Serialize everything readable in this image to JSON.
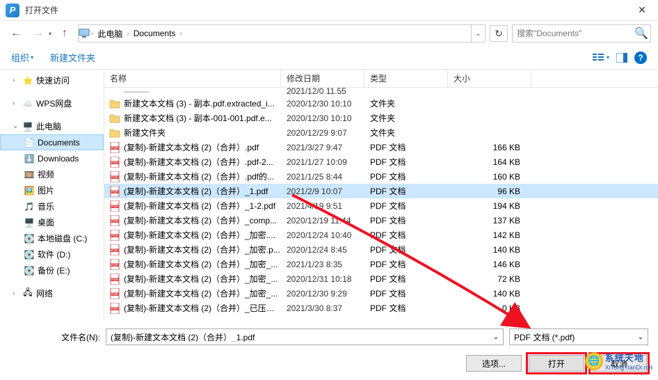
{
  "title": "打开文件",
  "breadcrumb": {
    "pc": "此电脑",
    "docs": "Documents"
  },
  "search_placeholder": "搜索\"Documents\"",
  "toolbar": {
    "organize": "组织",
    "newfolder": "新建文件夹"
  },
  "sidebar": {
    "quick": "快速访问",
    "wps": "WPS网盘",
    "thispc": "此电脑",
    "documents": "Documents",
    "downloads": "Downloads",
    "videos": "视频",
    "pictures": "图片",
    "music": "音乐",
    "desktop": "桌面",
    "diskc": "本地磁盘 (C:)",
    "diskd": "软件 (D:)",
    "diske": "备份 (E:)",
    "network": "网络"
  },
  "cols": {
    "name": "名称",
    "date": "修改日期",
    "type": "类型",
    "size": "大小"
  },
  "files": [
    {
      "name": "新建文本文档 (3) - 副本.pdf.extracted_i...",
      "date": "2020/12/30 10:10",
      "type": "文件夹",
      "size": "",
      "icon": "folder"
    },
    {
      "name": "新建文本文档 (3) - 副本-001-001.pdf.e...",
      "date": "2020/12/30 10:10",
      "type": "文件夹",
      "size": "",
      "icon": "folder"
    },
    {
      "name": "新建文件夹",
      "date": "2020/12/29 9:07",
      "type": "文件夹",
      "size": "",
      "icon": "folder"
    },
    {
      "name": "(复制)-新建文本文档 (2)（合并）.pdf",
      "date": "2021/3/27 9:47",
      "type": "PDF 文档",
      "size": "166 KB",
      "icon": "pdf"
    },
    {
      "name": "(复制)-新建文本文档 (2)（合并）.pdf-2...",
      "date": "2021/1/27 10:09",
      "type": "PDF 文档",
      "size": "164 KB",
      "icon": "pdf"
    },
    {
      "name": "(复制)-新建文本文档 (2)（合并）.pdf的...",
      "date": "2021/1/25 8:44",
      "type": "PDF 文档",
      "size": "160 KB",
      "icon": "pdf"
    },
    {
      "name": "(复制)-新建文本文档 (2)（合并）_1.pdf",
      "date": "2021/2/9 10:07",
      "type": "PDF 文档",
      "size": "96 KB",
      "icon": "pdf",
      "selected": true
    },
    {
      "name": "(复制)-新建文本文档 (2)（合并）_1-2.pdf",
      "date": "2021/4/19 9:51",
      "type": "PDF 文档",
      "size": "194 KB",
      "icon": "pdf"
    },
    {
      "name": "(复制)-新建文本文档 (2)（合并）_comp...",
      "date": "2020/12/19 11:44",
      "type": "PDF 文档",
      "size": "137 KB",
      "icon": "pdf"
    },
    {
      "name": "(复制)-新建文本文档 (2)（合并）_加密....",
      "date": "2020/12/24 10:40",
      "type": "PDF 文档",
      "size": "142 KB",
      "icon": "pdf"
    },
    {
      "name": "(复制)-新建文本文档 (2)（合并）_加密.p...",
      "date": "2020/12/24 8:45",
      "type": "PDF 文档",
      "size": "140 KB",
      "icon": "pdf"
    },
    {
      "name": "(复制)-新建文本文档 (2)（合并）_加密_...",
      "date": "2021/1/23 8:35",
      "type": "PDF 文档",
      "size": "146 KB",
      "icon": "pdf"
    },
    {
      "name": "(复制)-新建文本文档 (2)（合并）_加密_...",
      "date": "2020/12/31 10:18",
      "type": "PDF 文档",
      "size": "72 KB",
      "icon": "pdf"
    },
    {
      "name": "(复制)-新建文本文档 (2)（合并）_加密_...",
      "date": "2020/12/30 9:29",
      "type": "PDF 文档",
      "size": "140 KB",
      "icon": "pdf"
    },
    {
      "name": "(复制)-新建文本文档 (2)（合并）_已压缩...",
      "date": "2021/3/30 8:37",
      "type": "PDF 文档",
      "size": "0 KB",
      "icon": "pdf"
    }
  ],
  "cutoff_row_date": "2021/12/0 11.55",
  "footer": {
    "filename_label": "文件名(N):",
    "filename_value": "(复制)-新建文本文档 (2)（合并）_1.pdf",
    "filter": "PDF 文档 (*.pdf)",
    "options": "选项...",
    "open": "打开",
    "cancel": "取消"
  },
  "watermark": {
    "text1": "系统天地",
    "text2": "XiTongTianDi.net"
  }
}
